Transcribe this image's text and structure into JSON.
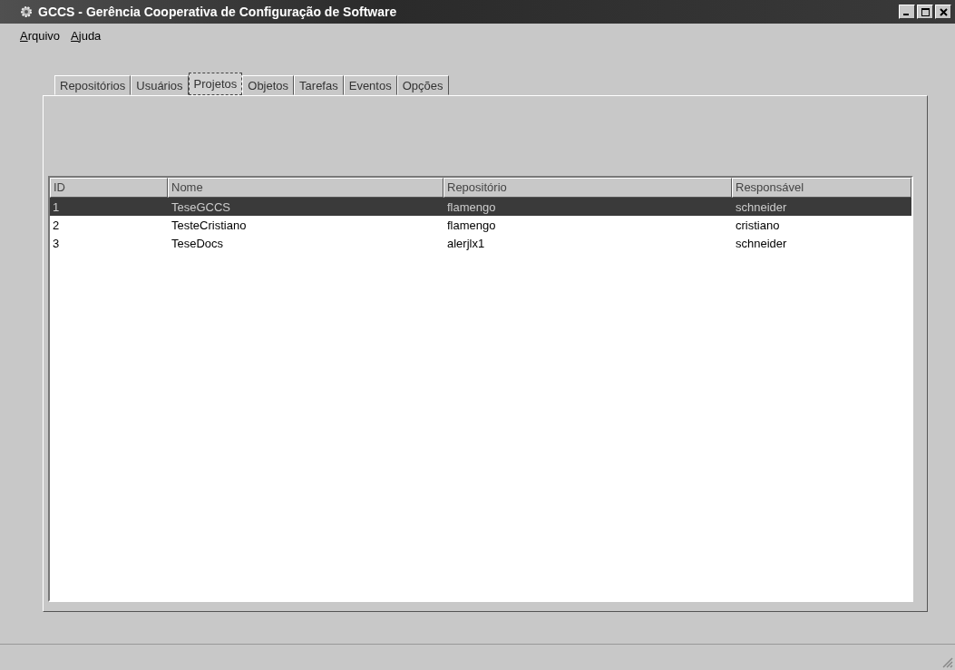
{
  "window": {
    "title": "GCCS - Gerência Cooperativa de Configuração de Software"
  },
  "menu": [
    "Arquivo",
    "Ajuda"
  ],
  "tabs": [
    {
      "label": "Repositórios",
      "selected": false
    },
    {
      "label": "Usuários",
      "selected": false
    },
    {
      "label": "Projetos",
      "selected": true
    },
    {
      "label": "Objetos",
      "selected": false
    },
    {
      "label": "Tarefas",
      "selected": false
    },
    {
      "label": "Eventos",
      "selected": false
    },
    {
      "label": "Opções",
      "selected": false
    }
  ],
  "table": {
    "columns": [
      "ID",
      "Nome",
      "Repositório",
      "Responsável"
    ],
    "rows": [
      {
        "cells": [
          "1",
          "TeseGCCS",
          "flamengo",
          "schneider"
        ],
        "selected": true
      },
      {
        "cells": [
          "2",
          "TesteCristiano",
          "flamengo",
          "cristiano"
        ],
        "selected": false
      },
      {
        "cells": [
          "3",
          "TeseDocs",
          "alerjlx1",
          "schneider"
        ],
        "selected": false
      }
    ]
  }
}
